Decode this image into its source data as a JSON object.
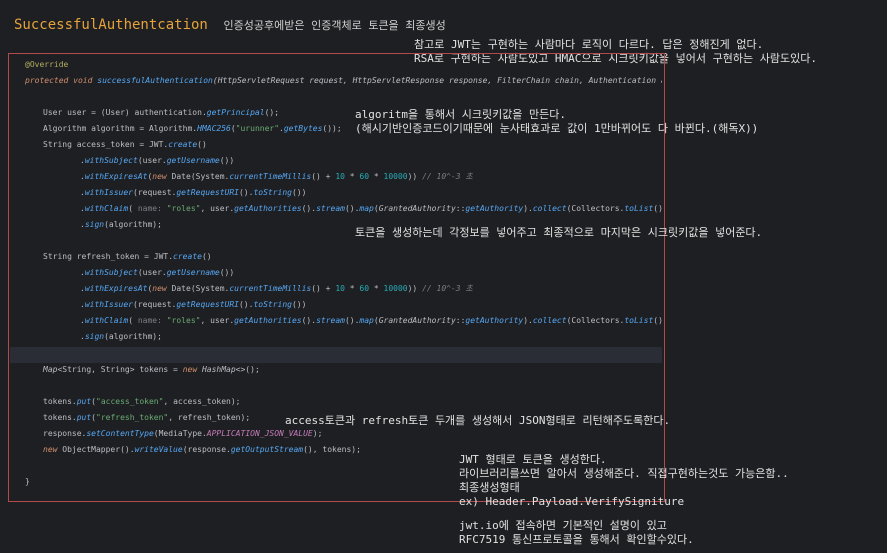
{
  "header": {
    "title": "SuccessfulAuthentcation",
    "subtitle": "인증성공후에받은 인증객체로 토큰을 최종생성"
  },
  "notes": {
    "n1_line1": "참고로 JWT는 구현하는 사람마다 로직이 다르다. 답은 정해진게 없다.",
    "n1_line2": "RSA로 구현하는 사람도있고 HMAC으로 시크릿키값을 넣어서 구현하는 사람도있다.",
    "n2_line1": "algoritm을 통해서 시크릿키값을 만든다.",
    "n2_line2": "(해시기반인증코드이기때문에 눈사태효과로 값이 1만바뀌어도 다 바뀐다.(해독X))",
    "n3": "토큰을 생성하는데 각정보를 넣어주고 최종적으로 마지막은 시크릿키값을 넣어준다.",
    "n4": "access토큰과 refresh토큰 두개를 생성해서 JSON형태로 리턴해주도록한다.",
    "n5_line1": "JWT 형태로 토큰을 생성한다.",
    "n5_line2": "라이브러리를쓰면 알아서 생성해준다. 직접구현하는것도 가능은함..",
    "n5_line3": "최종생성형태",
    "n5_line4": "ex) Header.Payload.VerifySigniture",
    "n5_line5": "jwt.io에 접속하면 기본적인 설명이 있고",
    "n5_line6": "RFC7519 통신프로토콜을 통해서 확인할수있다."
  },
  "code": {
    "override": "@Override",
    "kw_protected": "protected ",
    "kw_void": "void ",
    "method_name": "successfulAuthentication",
    "sig_open": "(",
    "t_req": "HttpServletRequest",
    "p_req": " request, ",
    "t_res": "HttpServletResponse",
    "p_res": " response, ",
    "t_chain": "FilterChain",
    "p_chain": " chain, ",
    "t_auth": "Authentication",
    "p_auth": " authen",
    "l_user_a": "User user = (User) authentication.",
    "l_user_m": "getPrincipal",
    "l_user_b": "();",
    "l_alg_a": "Algorithm algorithm = Algorithm.",
    "l_alg_m": "HMAC256",
    "l_alg_b": "(",
    "l_alg_s": "\"urunner\"",
    "l_alg_c": ".",
    "l_alg_m2": "getBytes",
    "l_alg_d": "());",
    "l_acc_a": "String access_token = JWT.",
    "l_create": "create",
    "l_paren_end": "()",
    "l_dot": ".",
    "m_withSubject": "withSubject",
    "l_subj_b": "(user.",
    "m_getUsername": "getUsername",
    "l_subj_c": "())",
    "m_withExpiresAt": "withExpiresAt",
    "l_exp_b": "(",
    "kw_new": "new ",
    "l_exp_c": "Date(System.",
    "m_ctm": "currentTimeMillis",
    "l_exp_d": "() + ",
    "n_10": "10",
    "l_mul": " * ",
    "n_60": "60",
    "n_10000": "10000",
    "l_exp_e": ")) ",
    "c_exp": "// 10^-3 초",
    "m_withIssuer": "withIssuer",
    "l_iss_b": "(request.",
    "m_getRequestURI": "getRequestURI",
    "l_iss_c": "().",
    "m_toString": "toString",
    "l_iss_d": "())",
    "m_withClaim": "withClaim",
    "l_cl_b": "( ",
    "h_name": "name: ",
    "s_roles": "\"roles\"",
    "l_cl_c": ", user.",
    "m_getAuthorities": "getAuthorities",
    "l_cl_d": "().",
    "m_stream": "stream",
    "m_map": "map",
    "l_cl_e": "(",
    "t_ga": "GrantedAuthority",
    "l_cl_f": "::",
    "m_getAuthority": "getAuthority",
    "l_cl_g": ").",
    "m_collect": "collect",
    "l_cl_h": "(Collectors.",
    "m_toList": "toList",
    "l_cl_i": "()))",
    "m_sign": "sign",
    "l_sign_b": "(algorithm);",
    "l_ref_a": "String refresh_token = JWT.",
    "t_map": "Map",
    "l_map_b": "<String, String> tokens = ",
    "l_map_c": "HashMap",
    "l_map_d": "<>();",
    "l_put1_a": "tokens.",
    "m_put": "put",
    "s_access": "\"access_token\"",
    "l_put1_c": ", access_token);",
    "s_refresh": "\"refresh_token\"",
    "l_put2_c": ", refresh_token);",
    "l_ct_a": "response.",
    "m_setContentType": "setContentType",
    "l_ct_b": "(MediaType.",
    "sf_json": "APPLICATION_JSON_VALUE",
    "l_ct_c": ");",
    "l_om_a": "ObjectMapper().",
    "m_writeValue": "writeValue",
    "l_om_b": "(response.",
    "m_getOutputStream": "getOutputStream",
    "l_om_c": "(), tokens);",
    "close_brace": "}"
  }
}
